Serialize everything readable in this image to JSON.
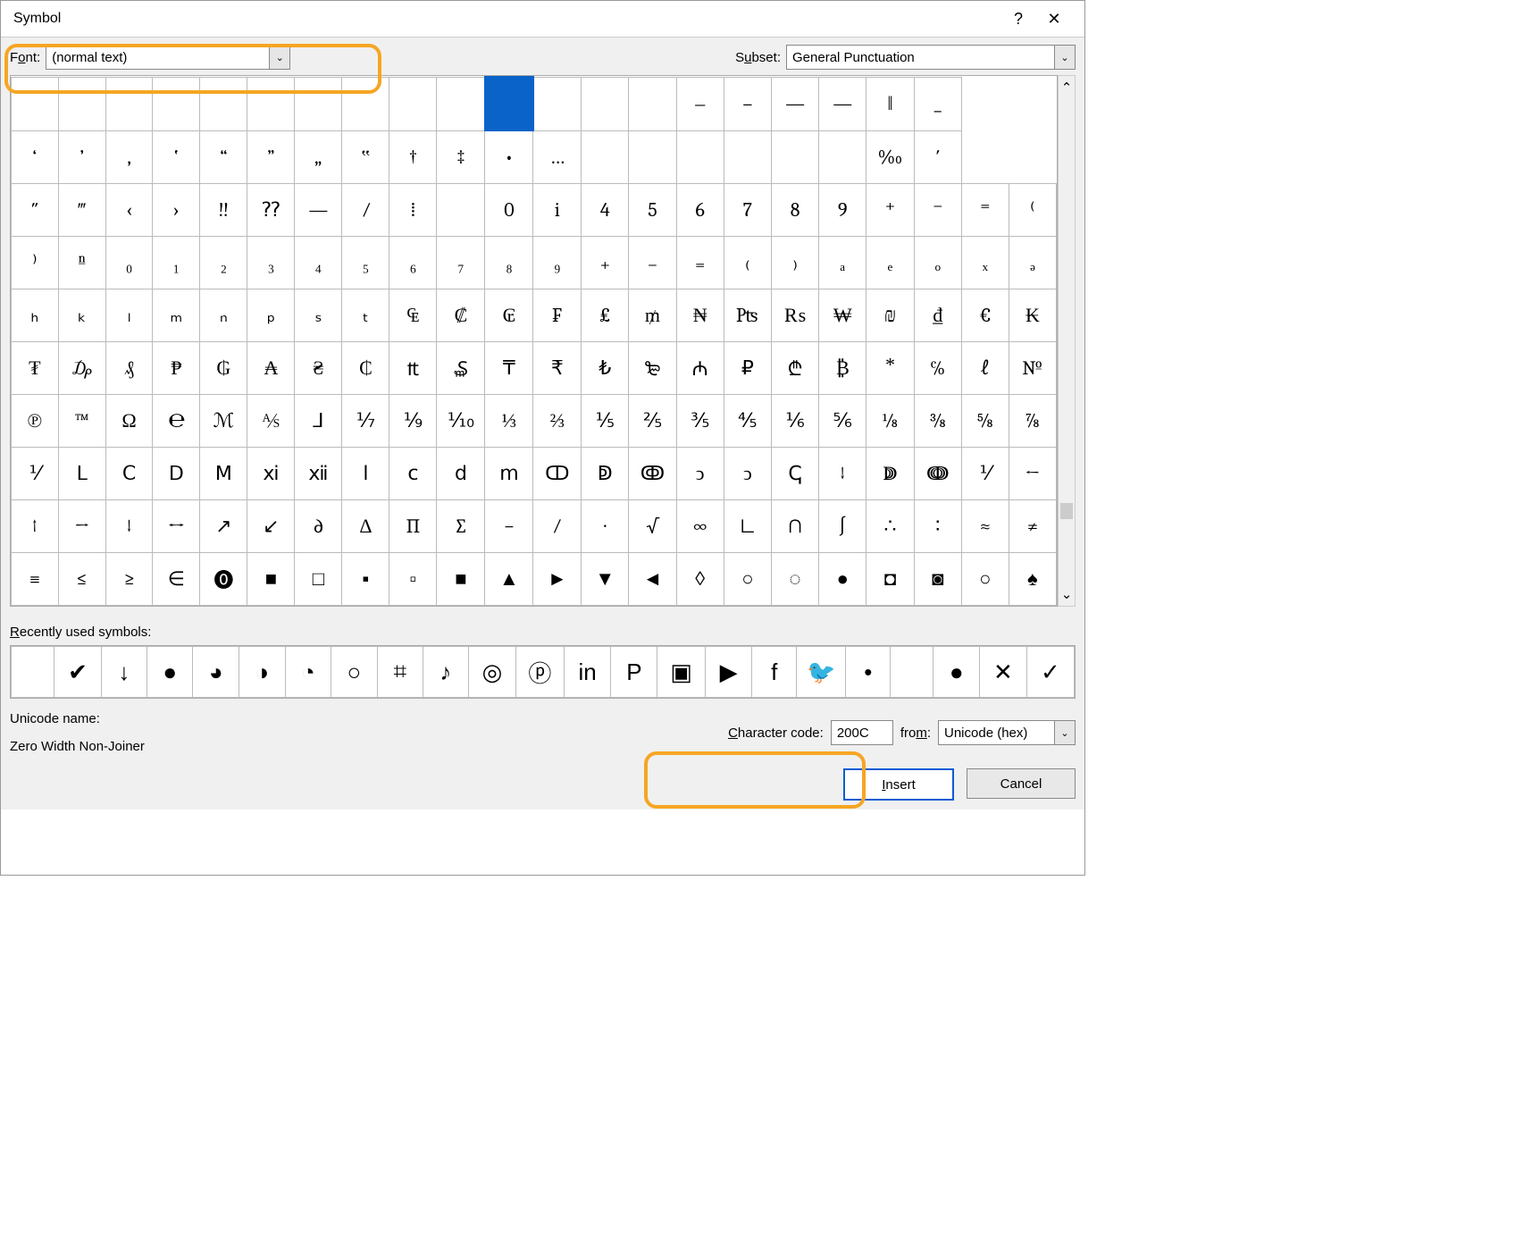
{
  "title": "Symbol",
  "help": "?",
  "close": "✕",
  "fontLabelPre": "F",
  "fontLabelU": "o",
  "fontLabelPost": "nt:",
  "fontValue": "(normal text)",
  "subsetLabelPre": "S",
  "subsetLabelU": "u",
  "subsetLabelPost": "bset:",
  "subsetValue": "General Punctuation",
  "grid": [
    [
      "",
      "",
      "",
      "",
      "",
      "",
      "",
      "",
      "",
      "",
      "SEL",
      "",
      "",
      "",
      "‒",
      "–",
      "—",
      "―",
      "‖",
      "_"
    ],
    [
      "‘",
      "’",
      "‚",
      "‛",
      "“",
      "”",
      "„",
      "‟",
      "†",
      "‡",
      "•",
      "…",
      "",
      "",
      "",
      "",
      "",
      "",
      "",
      "‟"
    ],
    [
      "′",
      "″",
      "‴",
      "",
      "",
      "",
      "‹",
      "›",
      "‼",
      "⁇",
      "—",
      "⁄",
      "⁞",
      "",
      "0",
      "i",
      "4",
      "5",
      "6",
      "7"
    ],
    [
      "8",
      "9",
      "⁺",
      "⁻",
      "⁼",
      "⁽",
      "⁾",
      "ⁿ",
      "n",
      "",
      "",
      "",
      "",
      "",
      "",
      "",
      "",
      "",
      "",
      "‰"
    ],
    [
      "",
      "",
      "",
      "",
      "",
      "",
      "",
      "",
      "",
      "",
      "",
      "",
      "",
      "",
      "",
      "",
      "",
      "",
      "",
      ""
    ],
    [
      "",
      "",
      "",
      "",
      "",
      "",
      "",
      "",
      "",
      "",
      "",
      "",
      "",
      "",
      "",
      "",
      "",
      "",
      "",
      ""
    ],
    [
      "",
      "",
      "",
      "",
      "",
      "",
      "",
      "",
      "",
      "",
      "",
      "",
      "",
      "",
      "",
      "",
      "",
      "",
      "",
      ""
    ],
    [
      "",
      "",
      "",
      "",
      "",
      "",
      "",
      "",
      "",
      "",
      "",
      "",
      "",
      "",
      "",
      "",
      "",
      "",
      "",
      ""
    ],
    [
      "",
      "",
      "",
      "",
      "",
      "",
      "",
      "",
      "",
      "",
      "",
      "",
      "",
      "",
      "",
      "",
      "",
      "",
      "",
      ""
    ],
    [
      "",
      "",
      "",
      "",
      "",
      "",
      "",
      "",
      "",
      "",
      "",
      "",
      "",
      "",
      "",
      "",
      "",
      "",
      "",
      ""
    ]
  ],
  "gridRows": [
    [
      "",
      "",
      "",
      "",
      "",
      "",
      "",
      "",
      "",
      "",
      "SEL",
      "",
      "",
      "",
      "‒",
      "–",
      "—",
      "―",
      "‖",
      "_"
    ],
    [
      "‘",
      "’",
      "‚",
      "‛",
      "“",
      "”",
      "„",
      "‟",
      "†",
      "‡",
      "•",
      "…",
      "",
      "",
      "",
      "",
      "",
      "",
      "‰",
      "′"
    ],
    [
      "″",
      "‴",
      "‹",
      "›",
      "‼",
      "⁇",
      "―",
      "⁄",
      "⁞",
      "",
      "0",
      "i",
      "4",
      "5",
      "6",
      "7",
      "8",
      "9",
      "⁺",
      "⁻",
      "⁼",
      "⁽"
    ],
    [
      "⁾",
      "ⁿ",
      "₀",
      "₁",
      "₂",
      "₃",
      "₄",
      "₅",
      "₆",
      "₇",
      "₈",
      "₉",
      "₊",
      "₋",
      "₌",
      "₍",
      "₎",
      "ₐ",
      "ₑ",
      "ₒ",
      "ₓ",
      "ₔ"
    ],
    [
      "ₕ",
      "ₖ",
      "ₗ",
      "ₘ",
      "ₙ",
      "ₚ",
      "ₛ",
      "ₜ",
      "₠",
      "₡",
      "₢",
      "₣",
      "₤",
      "₥",
      "₦",
      "₧",
      "₨",
      "₩",
      "₪",
      "₫",
      "€",
      "₭"
    ],
    [
      "₮",
      "₯",
      "₰",
      "₱",
      "₲",
      "₳",
      "₴",
      "₵",
      "₶",
      "₷",
      "₸",
      "₹",
      "₺",
      "₻",
      "₼",
      "₽",
      "₾",
      "₿",
      "⃰",
      "℅",
      "ℓ",
      "№"
    ],
    [
      "℗",
      "™",
      "Ω",
      "℮",
      "ℳ",
      "⅍",
      "⅃",
      "⅐",
      "⅑",
      "⅒",
      "⅓",
      "⅔",
      "⅕",
      "⅖",
      "⅗",
      "⅘",
      "⅙",
      "⅚",
      "⅛",
      "⅜",
      "⅝",
      "⅞"
    ],
    [
      "⅟",
      "Ⅼ",
      "Ⅽ",
      "Ⅾ",
      "Ⅿ",
      "ⅺ",
      "ⅻ",
      "ⅼ",
      "ⅽ",
      "ⅾ",
      "ⅿ",
      "ↀ",
      "ↁ",
      "ↂ",
      "ↄ",
      "ↄ",
      "ↅ",
      "↓",
      "ↇ",
      "ↈ",
      "⅟",
      "←"
    ],
    [
      "↑",
      "→",
      "↓",
      "↔",
      "↗",
      "↙",
      "∂",
      "Δ",
      "∏",
      "∑",
      "−",
      "∕",
      "∙",
      "√",
      "∞",
      "∟",
      "∩",
      "∫",
      "∴",
      "∶",
      "≈",
      "≠"
    ],
    [
      "≡",
      "≤",
      "≥",
      "∈",
      "⓿",
      "■",
      "□",
      "▪",
      "▫",
      "■",
      "▲",
      "►",
      "▼",
      "◄",
      "◊",
      "○",
      "◌",
      "●",
      "◘",
      "◙",
      "○",
      "♠"
    ]
  ],
  "recentLabelPre": "R",
  "recentLabelU": "e",
  "recentLabelPost": "cently used symbols:",
  "recent": [
    "",
    "✔",
    "↓",
    "●",
    "◕",
    "◑",
    "◔",
    "○",
    "⌗",
    "♪",
    "◎",
    "ⓟ",
    "in",
    "P",
    "▣",
    "▶",
    "f",
    "🐦",
    "•",
    "",
    "●",
    "✕",
    "✓"
  ],
  "recentIcons": [
    "",
    "check",
    "down-arrow",
    "black-circle",
    "pie-3q",
    "half-circle",
    "pie-1q",
    "circle",
    "hash",
    "tiktok",
    "instagram",
    "pinterest",
    "linkedin",
    "pinterest-p",
    "instagram-sq",
    "youtube",
    "facebook",
    "twitter",
    "bullet",
    "",
    "black-circle2",
    "x-mark",
    "check-light"
  ],
  "unicodeNameLabel": "Unicode name:",
  "unicodeName": "Zero Width Non-Joiner",
  "charCodeLabelPre": "C",
  "charCodeLabelU": "h",
  "charCodeLabelPost": "aracter code:",
  "charCode": "200C",
  "fromLabelPre": "fro",
  "fromLabelU": "m",
  "fromLabelPost": ":",
  "fromValue": "Unicode (hex)",
  "insertPre": "I",
  "insertU": "n",
  "insertPost": "sert",
  "cancel": "Cancel",
  "dd": "⌄",
  "sbUp": "⌃",
  "sbDn": "⌄"
}
